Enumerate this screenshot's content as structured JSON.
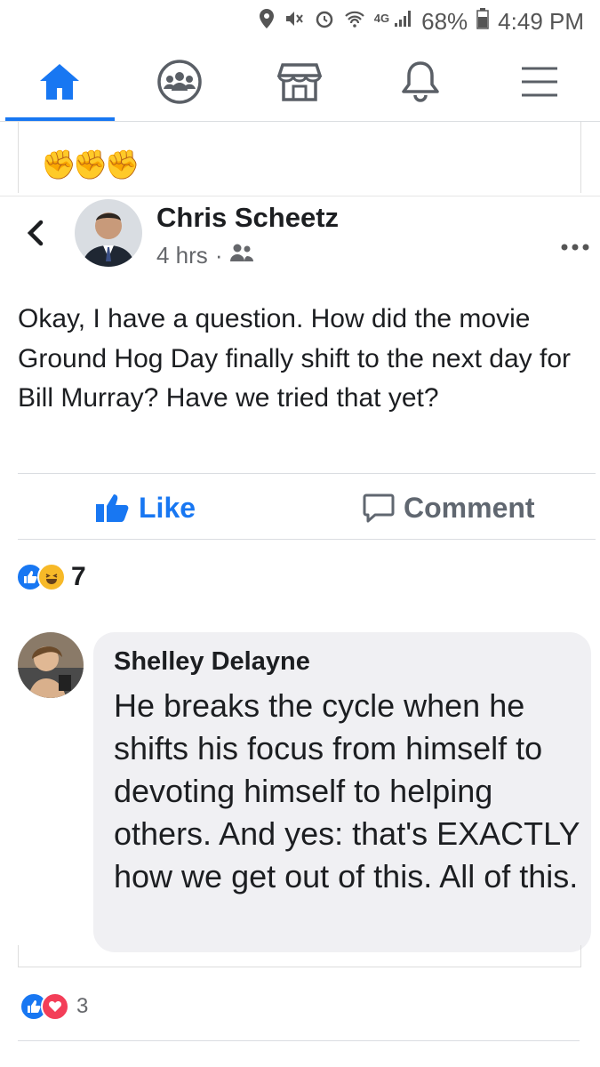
{
  "status": {
    "battery": "68%",
    "time": "4:49 PM",
    "network": "4G"
  },
  "nav": {
    "items": [
      "home-icon",
      "groups-icon",
      "marketplace-icon",
      "notifications-icon",
      "menu-icon"
    ],
    "accent": "#1877f2"
  },
  "emoji_header": "✊✊✊",
  "post": {
    "author": "Chris Scheetz",
    "time": "4 hrs",
    "separator": "·",
    "text": "Okay, I have a question. How did the movie Ground Hog Day finally shift to the next day for Bill Murray? Have we tried that yet?",
    "like_label": "Like",
    "comment_label": "Comment",
    "reaction_count": "7"
  },
  "comment": {
    "author": "Shelley Delayne",
    "text": "He breaks the cycle when he shifts his focus from himself to devoting himself to helping others. And yes: that's EXACTLY how we get out of this. All of this."
  },
  "bottom": {
    "reaction_count": "3"
  }
}
